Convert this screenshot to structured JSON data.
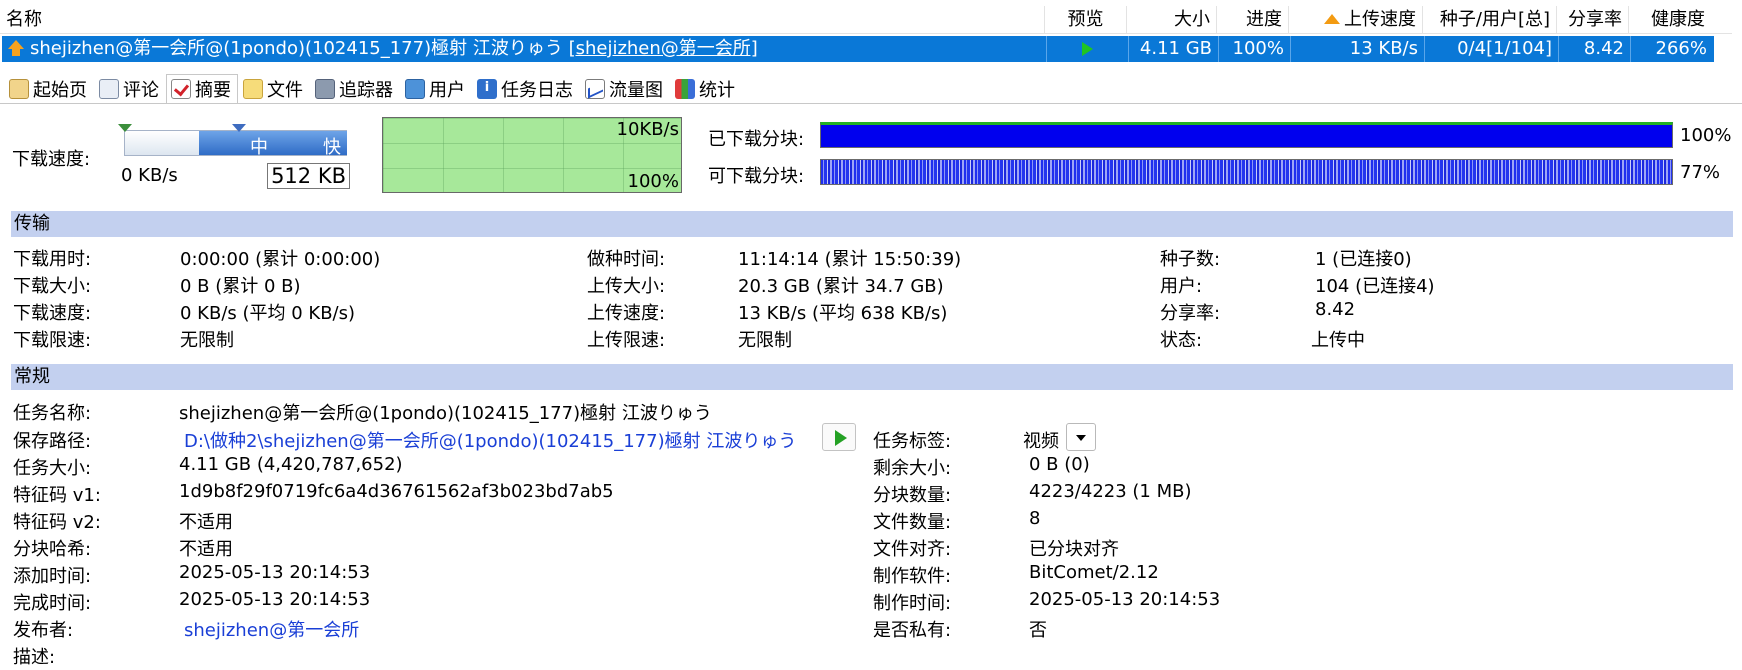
{
  "task_list": {
    "columns": [
      "名称",
      "预览",
      "大小",
      "进度",
      "上传速度",
      "种子/用户[总]",
      "分享率",
      "健康度"
    ],
    "row": {
      "name": "shejizhen@第一会所@(1pondo)(102415_177)極射 江波りゅう",
      "name_link": "[shejizhen@第一会所]",
      "size": "4.11 GB",
      "progress": "100%",
      "upload_speed": "13 KB/s",
      "peers": "0/4[1/104]",
      "ratio": "8.42",
      "health": "266%"
    }
  },
  "tabs": [
    "起始页",
    "评论",
    "摘要",
    "文件",
    "追踪器",
    "用户",
    "任务日志",
    "流量图",
    "统计"
  ],
  "active_tab": "摘要",
  "speed": {
    "label": "下载速度:",
    "value": "0 KB/s",
    "slider_mid": "中",
    "slider_fast": "快",
    "limit": "512 KB",
    "graph_max": "10KB/s",
    "graph_pct": "100%"
  },
  "pieces": {
    "downloaded_label": "已下载分块:",
    "downloaded_pct": "100%",
    "available_label": "可下载分块:",
    "available_pct": "77%"
  },
  "transfer": {
    "title": "传输",
    "col1": [
      {
        "label": "下载用时:",
        "value": "0:00:00 (累计 0:00:00)"
      },
      {
        "label": "下载大小:",
        "value": "0 B (累计 0 B)"
      },
      {
        "label": "下载速度:",
        "value": "0 KB/s (平均 0 KB/s)"
      },
      {
        "label": "下载限速:",
        "value": "无限制"
      }
    ],
    "col2": [
      {
        "label": "做种时间:",
        "value": "11:14:14 (累计 15:50:39)"
      },
      {
        "label": "上传大小:",
        "value": "20.3 GB (累计 34.7 GB)"
      },
      {
        "label": "上传速度:",
        "value": "13 KB/s (平均 638 KB/s)"
      },
      {
        "label": "上传限速:",
        "value": "无限制"
      }
    ],
    "col3": [
      {
        "label": "种子数:",
        "value": "1 (已连接0)"
      },
      {
        "label": "用户:",
        "value": "104 (已连接4)"
      },
      {
        "label": "分享率:",
        "value": "8.42"
      },
      {
        "label": "状态:",
        "value": "上传中"
      }
    ]
  },
  "general": {
    "title": "常规",
    "left": [
      {
        "label": "任务名称:",
        "value": "shejizhen@第一会所@(1pondo)(102415_177)極射 江波りゅう"
      },
      {
        "label": "保存路径:",
        "value": "D:\\做种2\\shejizhen@第一会所@(1pondo)(102415_177)極射 江波りゅう"
      },
      {
        "label": "任务大小:",
        "value": "4.11 GB (4,420,787,652)"
      },
      {
        "label": "特征码 v1:",
        "value": "1d9b8f29f0719fc6a4d36761562af3b023bd7ab5"
      },
      {
        "label": "特征码 v2:",
        "value": "不适用"
      },
      {
        "label": "分块哈希:",
        "value": "不适用"
      },
      {
        "label": "添加时间:",
        "value": "2025-05-13 20:14:53"
      },
      {
        "label": "完成时间:",
        "value": "2025-05-13 20:14:53"
      },
      {
        "label": "发布者:",
        "value": "shejizhen@第一会所"
      },
      {
        "label": "描述:",
        "value": ""
      }
    ],
    "right": [
      {
        "label": "任务标签:",
        "value": "视频"
      },
      {
        "label": "剩余大小:",
        "value": "0 B (0)"
      },
      {
        "label": "分块数量:",
        "value": "4223/4223 (1 MB)"
      },
      {
        "label": "文件数量:",
        "value": "8"
      },
      {
        "label": "文件对齐:",
        "value": "已分块对齐"
      },
      {
        "label": "制作软件:",
        "value": "BitComet/2.12"
      },
      {
        "label": "制作时间:",
        "value": "2025-05-13 20:14:53"
      },
      {
        "label": "是否私有:",
        "value": "否"
      }
    ]
  }
}
